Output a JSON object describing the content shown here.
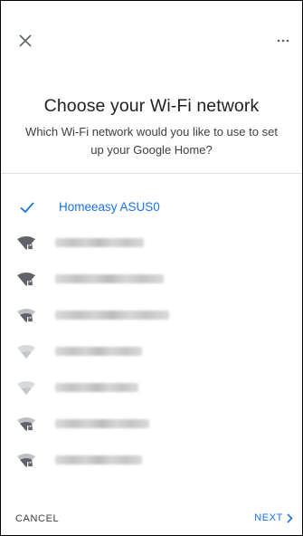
{
  "header": {
    "title": "Choose your Wi-Fi network",
    "subtitle": "Which Wi-Fi network would you like to use to set up your Google Home?"
  },
  "networks": [
    {
      "label": "Homeeasy ASUS0",
      "selected": true,
      "icon": "check-icon"
    },
    {
      "label": "",
      "icon": "wifi-locked-strong-icon",
      "blurred": true
    },
    {
      "label": "",
      "icon": "wifi-locked-strong-icon",
      "blurred": true
    },
    {
      "label": "",
      "icon": "wifi-locked-medium-icon",
      "blurred": true
    },
    {
      "label": "",
      "icon": "wifi-weak-icon",
      "blurred": true
    },
    {
      "label": "",
      "icon": "wifi-weak-icon",
      "blurred": true
    },
    {
      "label": "",
      "icon": "wifi-locked-medium-icon",
      "blurred": true
    },
    {
      "label": "",
      "icon": "wifi-locked-medium-icon",
      "blurred": true
    }
  ],
  "footer": {
    "cancel_label": "CANCEL",
    "next_label": "NEXT"
  },
  "colors": {
    "accent": "#1a73e8",
    "text": "#202124",
    "icon_strong": "#5f6368",
    "icon_weak": "#bdc1c6"
  }
}
